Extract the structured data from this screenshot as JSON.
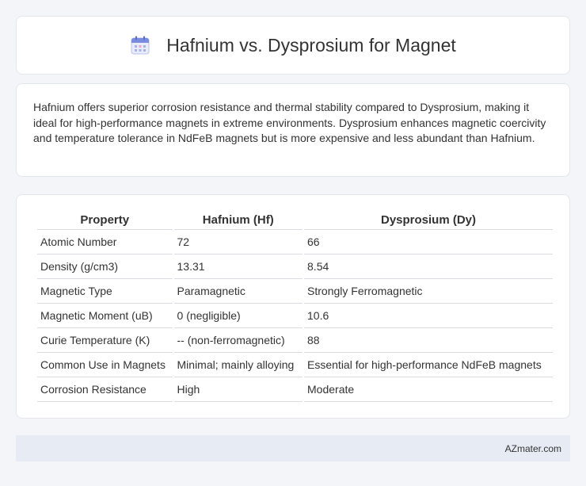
{
  "header": {
    "title": "Hafnium vs. Dysprosium for Magnet",
    "icon": "calendar-icon"
  },
  "summary": {
    "text": "Hafnium offers superior corrosion resistance and thermal stability compared to Dysprosium, making it ideal for high-performance magnets in extreme environments. Dysprosium enhances magnetic coercivity and temperature tolerance in NdFeB magnets but is more expensive and less abundant than Hafnium."
  },
  "table": {
    "headers": [
      "Property",
      "Hafnium (Hf)",
      "Dysprosium (Dy)"
    ],
    "rows": [
      [
        "Atomic Number",
        "72",
        "66"
      ],
      [
        "Density (g/cm3)",
        "13.31",
        "8.54"
      ],
      [
        "Magnetic Type",
        "Paramagnetic",
        "Strongly Ferromagnetic"
      ],
      [
        "Magnetic Moment (uB)",
        "0 (negligible)",
        "10.6"
      ],
      [
        "Curie Temperature (K)",
        "-- (non-ferromagnetic)",
        "88"
      ],
      [
        "Common Use in Magnets",
        "Minimal; mainly alloying",
        "Essential for high-performance NdFeB magnets"
      ],
      [
        "Corrosion Resistance",
        "High",
        "Moderate"
      ]
    ]
  },
  "footer": {
    "brand": "AZmater.com"
  },
  "colors": {
    "background": "#f3f5f9",
    "card": "#ffffff",
    "footer": "#e6ebf4",
    "icon_accent": "#7b8be0"
  }
}
